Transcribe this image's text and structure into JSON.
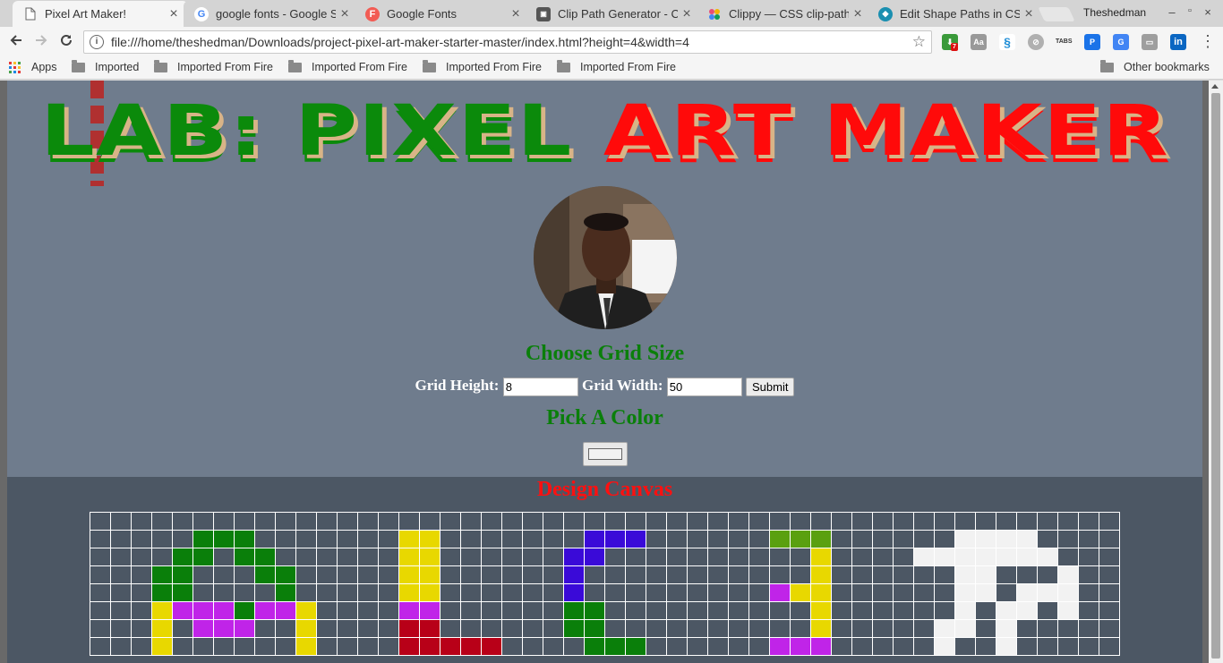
{
  "browser": {
    "tabs": [
      {
        "title": "Pixel Art Maker!",
        "active": true,
        "favicon": "page-icon"
      },
      {
        "title": "google fonts - Google S",
        "active": false,
        "favicon": "google-icon"
      },
      {
        "title": "Google Fonts",
        "active": false,
        "favicon": "google-fonts-icon"
      },
      {
        "title": "Clip Path Generator - C",
        "active": false,
        "favicon": "clippy-generator-icon"
      },
      {
        "title": "Clippy — CSS clip-path",
        "active": false,
        "favicon": "clippy-icon"
      },
      {
        "title": "Edit Shape Paths in CSS",
        "active": false,
        "favicon": "edit-shape-icon"
      }
    ],
    "profile_name": "Theshedman",
    "url": "file:///home/theshedman/Downloads/project-pixel-art-maker-starter-master/index.html?height=4&width=4",
    "extensions": [
      {
        "icon": "download-extension-icon",
        "badge": "7",
        "color": "#3a9a3a"
      },
      {
        "icon": "dictionary-extension-icon",
        "color": "#999999"
      },
      {
        "icon": "web-developer-extension-icon",
        "color": "#1f8dd6"
      },
      {
        "icon": "blocked-extension-icon",
        "color": "#b0b0b0"
      },
      {
        "icon": "tabs-extension-icon",
        "label": "TABS",
        "color": "#333333"
      },
      {
        "icon": "pushbullet-extension-icon",
        "color": "#1a73e8"
      },
      {
        "icon": "google-translate-extension-icon",
        "color": "#4285f4"
      },
      {
        "icon": "cast-extension-icon",
        "color": "#9e9e9e"
      },
      {
        "icon": "linkedin-extension-icon",
        "label": "in",
        "color": "#0a66c2"
      }
    ],
    "bookmarks": [
      {
        "label": "Apps",
        "type": "apps"
      },
      {
        "label": "Imported",
        "type": "folder"
      },
      {
        "label": "Imported From Fire",
        "type": "folder"
      },
      {
        "label": "Imported From Fire",
        "type": "folder"
      },
      {
        "label": "Imported From Fire",
        "type": "folder"
      },
      {
        "label": "Imported From Fire",
        "type": "folder"
      }
    ],
    "other_bookmarks": "Other bookmarks"
  },
  "page": {
    "headline_part1": "LAB: PIXEL",
    "headline_part2": "ART MAKER",
    "choose_heading": "Choose Grid Size",
    "height_label": "Grid Height:",
    "height_value": "8",
    "width_label": "Grid Width:",
    "width_value": "50",
    "submit_label": "Submit",
    "pick_heading": "Pick A Color",
    "current_color": "#f2f2f2",
    "canvas_heading": "Design Canvas"
  },
  "pixel_grid": {
    "rows": 8,
    "cols": 50,
    "background": "#4c5764",
    "palette": {
      "G": "#0a7f0a",
      "Y": "#e8d800",
      "P": "#c024e8",
      "R": "#b80018",
      "B": "#3a0ad8",
      "L": "#5aa010",
      "W": "#f2f2f2"
    },
    "cells": [
      "..................................................",
      "..........................................",
      "...............................................",
      "..........................................",
      "...............................................",
      "..............................................",
      "...............................................",
      "..............................................."
    ],
    "cells_fixed": [
      "..................................................",
      ".....GGG.......YY.......BBB......LLL......WWWW....",
      "....GG.GG......YY......BB..........Y....WWWWWWW...",
      "...GG...GG.....YY......B...........Y......WW...W..",
      "...GG....G.....YY......B.........PYY......WW.WWW..",
      "...YPPPGPPY....PP......GG..........Y......W.WW.W..",
      "...Y.PPP..Y....RR......GG..........Y.....WW.W.....",
      "...Y......Y....RRRRR....GGG......PPP.....W..W....."
    ]
  }
}
